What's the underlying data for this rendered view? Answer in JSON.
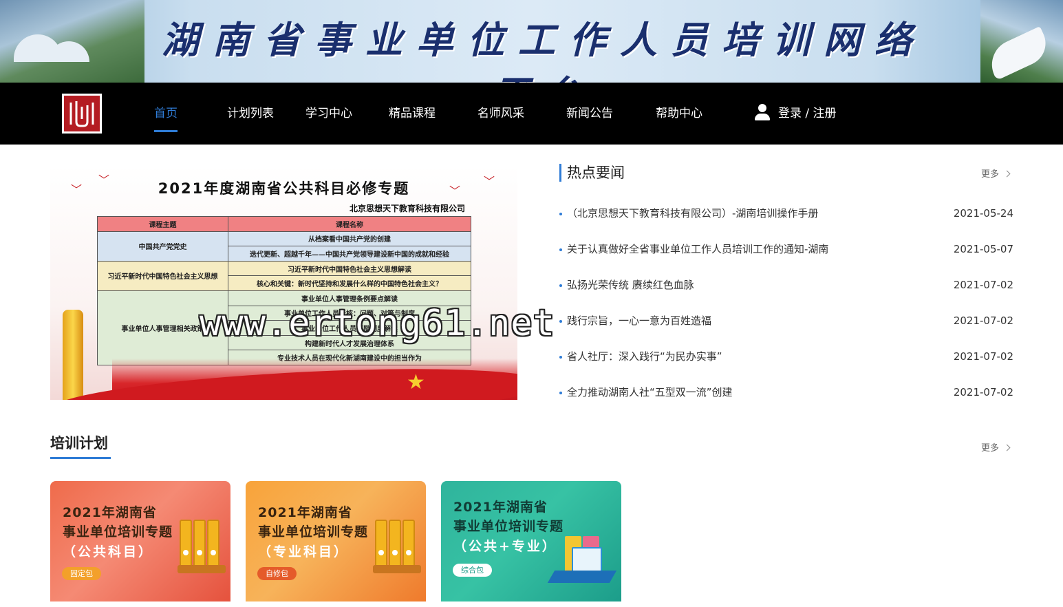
{
  "banner": {
    "title": "湖南省事业单位工作人员培训网络平台"
  },
  "nav": {
    "items": [
      {
        "label": "首页",
        "active": true
      },
      {
        "label": "计划列表"
      },
      {
        "label": "学习中心"
      },
      {
        "label": "精品课程"
      },
      {
        "label": "名师风采"
      },
      {
        "label": "新闻公告"
      },
      {
        "label": "帮助中心"
      }
    ],
    "login": "登录 / 注册",
    "login_icon": "user-icon",
    "accent_color": "#2f7cd6"
  },
  "feature": {
    "title": "2021年度湖南省公共科目必修专题",
    "subtitle": "北京思想天下教育科技有限公司",
    "table": {
      "headers": [
        "课程主题",
        "课程名称"
      ],
      "groups": [
        {
          "topic": "中国共产党党史",
          "courses": [
            "从档案看中国共产党的创建",
            "迭代更新、超越千年——中国共产党领导建设新中国的成就和经验"
          ]
        },
        {
          "topic": "习近平新时代中国特色社会主义思想",
          "courses": [
            "习近平新时代中国特色社会主义思想解读",
            "核心和关键：新时代坚持和发展什么样的中国特色社会主义？"
          ]
        },
        {
          "topic": "事业单位人事管理相关政策",
          "courses": [
            "事业单位人事管理条例要点解读",
            "事业单位工作人员考核：问题、对策与制度",
            "事业单位工作人员奖励制度解读",
            "构建新时代人才发展治理体系",
            "专业技术人员在现代化新湖南建设中的担当作为"
          ]
        }
      ]
    }
  },
  "watermark": "www.ertong61.net",
  "news": {
    "heading": "热点要闻",
    "more": "更多",
    "items": [
      {
        "title": "（北京思想天下教育科技有限公司）-湖南培训操作手册",
        "date": "2021-05-24"
      },
      {
        "title": "关于认真做好全省事业单位工作人员培训工作的通知-湖南",
        "date": "2021-05-07"
      },
      {
        "title": "弘扬光荣传统 赓续红色血脉",
        "date": "2021-07-02"
      },
      {
        "title": "践行宗旨，一心一意为百姓造福",
        "date": "2021-07-02"
      },
      {
        "title": "省人社厅：深入践行“为民办实事”",
        "date": "2021-07-02"
      },
      {
        "title": "全力推动湖南人社“五型双一流”创建",
        "date": "2021-07-02"
      }
    ]
  },
  "plan": {
    "heading": "培训计划",
    "more": "更多",
    "cards": [
      {
        "line1": "2021年湖南省",
        "line2": "事业单位培训专题",
        "sub": "（公共科目）",
        "tag": "固定包"
      },
      {
        "line1": "2021年湖南省",
        "line2": "事业单位培训专题",
        "sub": "（专业科目）",
        "tag": "自修包"
      },
      {
        "line1": "2021年湖南省",
        "line2": "事业单位培训专题",
        "sub": "（公共+专业）",
        "tag": "综合包"
      }
    ]
  }
}
